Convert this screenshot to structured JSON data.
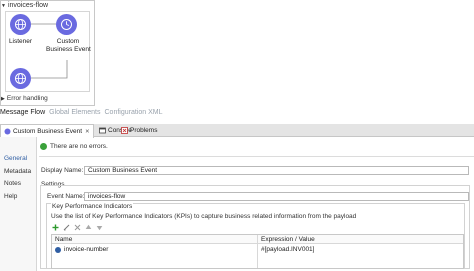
{
  "flow": {
    "name": "invoices-flow",
    "nodes": [
      {
        "label_lines": [
          "Listener"
        ]
      },
      {
        "label_lines": [
          "Custom",
          "Business Event"
        ]
      },
      {
        "label_lines": []
      }
    ],
    "error_handling": "Error handling"
  },
  "editor_tabs": [
    "Message Flow",
    "Global Elements",
    "Configuration XML"
  ],
  "view_tabs": [
    {
      "label": "Custom Business Event",
      "close": "✕"
    },
    {
      "label": "Console"
    },
    {
      "label": "Problems"
    }
  ],
  "side_nav": [
    "General",
    "Metadata",
    "Notes",
    "Help"
  ],
  "status": "There are no errors.",
  "display_name": {
    "label": "Display Name:",
    "value": "Custom Business Event"
  },
  "settings": {
    "title": "Settings",
    "event_name": {
      "label": "Event Name:",
      "value": "invoices-flow"
    },
    "kpi": {
      "title": "Key Performance Indicators",
      "description": "Use the list of Key Performance Indicators (KPIs) to capture business related information from the payload",
      "columns": [
        "Name",
        "Expression / Value"
      ],
      "rows": [
        {
          "name": "invoice-number",
          "expression": "#[payload.INV001]"
        }
      ]
    }
  },
  "colors": {
    "node": "#6a6ae0",
    "accent": "#2f5ea3",
    "ok": "#3aa13a"
  }
}
